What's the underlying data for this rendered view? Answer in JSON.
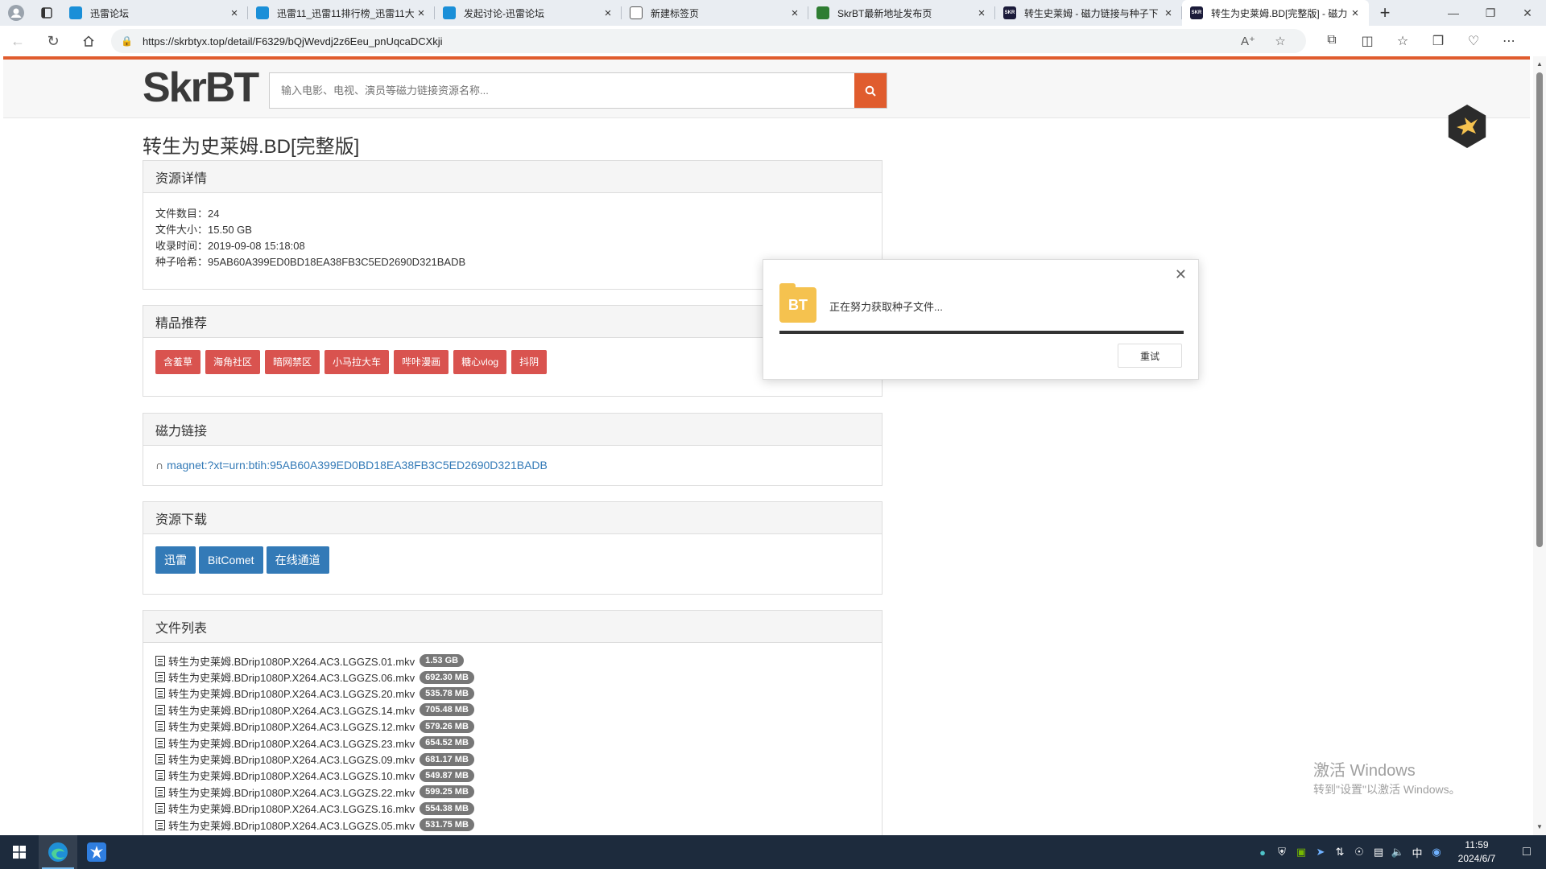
{
  "browser": {
    "tabs": [
      {
        "title": "迅雷论坛",
        "favicon_color": "#1a8fd8"
      },
      {
        "title": "迅雷11_迅雷11排行榜_迅雷11大",
        "favicon_color": "#1a8fd8"
      },
      {
        "title": "发起讨论-迅雷论坛",
        "favicon_color": "#1a8fd8"
      },
      {
        "title": "新建标签页",
        "favicon_color": "#ffffff"
      },
      {
        "title": "SkrBT最新地址发布页",
        "favicon_color": "#2e7d32"
      },
      {
        "title": "转生史莱姆 - 磁力链接与种子下",
        "favicon_color": "#1b1b3a",
        "favicon_text": "SKR"
      },
      {
        "title": "转生为史莱姆.BD[完整版] - 磁力",
        "favicon_color": "#1b1b3a",
        "favicon_text": "SKR",
        "active": true
      }
    ],
    "url": "https://skrbtyx.top/detail/F6329/bQjWevdj2z6Eeu_pnUqcaDCXkji"
  },
  "site": {
    "logo": "SkrBT",
    "search_placeholder": "输入电影、电视、演员等磁力链接资源名称...",
    "accent_color": "#e05c2e"
  },
  "page": {
    "title": "转生为史莱姆.BD[完整版]",
    "details": {
      "header": "资源详情",
      "rows": [
        {
          "label": "文件数目：",
          "value": "24"
        },
        {
          "label": "文件大小：",
          "value": "15.50 GB"
        },
        {
          "label": "收录时间：",
          "value": "2019-09-08 15:18:08"
        },
        {
          "label": "种子哈希：",
          "value": "95AB60A399ED0BD18EA38FB3C5ED2690D321BADB"
        }
      ]
    },
    "recommend": {
      "header": "精品推荐",
      "tags": [
        "含羞草",
        "海角社区",
        "暗网禁区",
        "小马拉大车",
        "哔咔漫画",
        "糖心vlog",
        "抖阴"
      ]
    },
    "magnet": {
      "header": "磁力链接",
      "link": "magnet:?xt=urn:btih:95AB60A399ED0BD18EA38FB3C5ED2690D321BADB"
    },
    "download": {
      "header": "资源下载",
      "buttons": [
        "迅雷",
        "BitComet",
        "在线通道"
      ]
    },
    "files": {
      "header": "文件列表",
      "items": [
        {
          "name": "转生为史莱姆.BDrip1080P.X264.AC3.LGGZS.01.mkv",
          "size": "1.53 GB"
        },
        {
          "name": "转生为史莱姆.BDrip1080P.X264.AC3.LGGZS.06.mkv",
          "size": "692.30 MB"
        },
        {
          "name": "转生为史莱姆.BDrip1080P.X264.AC3.LGGZS.20.mkv",
          "size": "535.78 MB"
        },
        {
          "name": "转生为史莱姆.BDrip1080P.X264.AC3.LGGZS.14.mkv",
          "size": "705.48 MB"
        },
        {
          "name": "转生为史莱姆.BDrip1080P.X264.AC3.LGGZS.12.mkv",
          "size": "579.26 MB"
        },
        {
          "name": "转生为史莱姆.BDrip1080P.X264.AC3.LGGZS.23.mkv",
          "size": "654.52 MB"
        },
        {
          "name": "转生为史莱姆.BDrip1080P.X264.AC3.LGGZS.09.mkv",
          "size": "681.17 MB"
        },
        {
          "name": "转生为史莱姆.BDrip1080P.X264.AC3.LGGZS.10.mkv",
          "size": "549.87 MB"
        },
        {
          "name": "转生为史莱姆.BDrip1080P.X264.AC3.LGGZS.22.mkv",
          "size": "599.25 MB"
        },
        {
          "name": "转生为史莱姆.BDrip1080P.X264.AC3.LGGZS.16.mkv",
          "size": "554.38 MB"
        },
        {
          "name": "转生为史莱姆.BDrip1080P.X264.AC3.LGGZS.05.mkv",
          "size": "531.75 MB"
        }
      ]
    }
  },
  "dialog": {
    "icon_text": "BT",
    "message": "正在努力获取种子文件...",
    "progress_fraction": 1.0,
    "retry_label": "重试"
  },
  "watermark": {
    "line1": "激活 Windows",
    "line2": "转到\"设置\"以激活 Windows。"
  },
  "taskbar": {
    "time": "11:59",
    "date": "2024/6/7",
    "ime": "中"
  }
}
